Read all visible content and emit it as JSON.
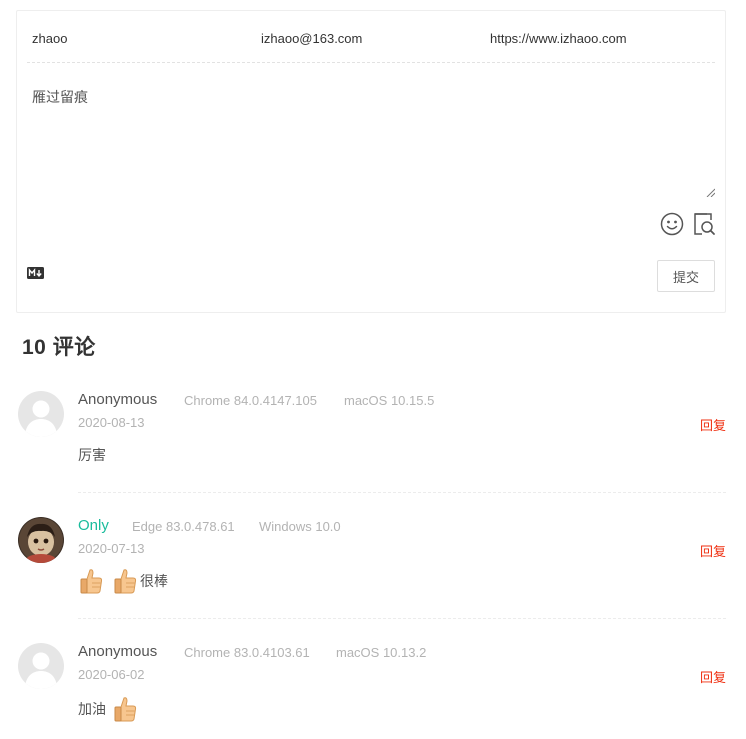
{
  "editor": {
    "nick_value": "zhaoo",
    "mail_value": "izhaoo@163.com",
    "link_value": "https://www.izhaoo.com",
    "textarea_value": "雁过留痕",
    "submit_label": "提交",
    "icons": [
      "emoji-icon",
      "preview-icon",
      "markdown-icon",
      "resize-grip-icon"
    ]
  },
  "count": {
    "label": "10 评论"
  },
  "comments": [
    {
      "nick": "Anonymous",
      "browser": "Chrome 84.0.4147.105",
      "os": "macOS 10.15.5",
      "time": "2020-08-13",
      "reply": "回复",
      "text": "厉害",
      "avatar": "default-avatar"
    },
    {
      "nick": "Only",
      "browser": "Edge 83.0.478.61",
      "os": "Windows 10.0",
      "time": "2020-07-13",
      "reply": "回复",
      "text": "很棒",
      "avatar": "photo-avatar",
      "nick_color": "#1abc9c"
    },
    {
      "nick": "Anonymous",
      "browser": "Chrome 83.0.4103.61",
      "os": "macOS 10.13.2",
      "time": "2020-06-02",
      "reply": "回复",
      "text": "加油",
      "avatar": "default-avatar"
    }
  ],
  "colors": {
    "accent": "#1abc9c",
    "reply": "#ef2f11",
    "muted": "#b3b3b3"
  }
}
